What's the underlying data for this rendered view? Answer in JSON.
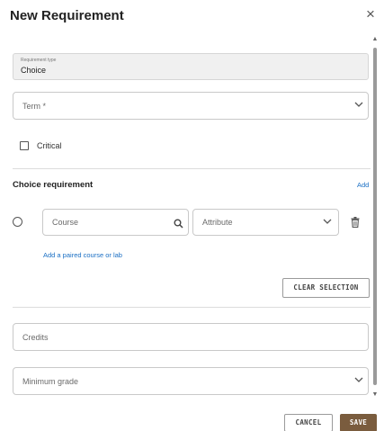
{
  "dialog": {
    "title": "New Requirement",
    "close_symbol": "×"
  },
  "requirement_type": {
    "label": "Requirement type",
    "value": "Choice"
  },
  "term": {
    "placeholder": "Term *"
  },
  "critical": {
    "label": "Critical",
    "checked": false
  },
  "choice_requirement": {
    "title": "Choice requirement",
    "add_label": "Add",
    "course_placeholder": "Course",
    "attribute_placeholder": "Attribute",
    "paired_link": "Add a paired course or lab",
    "clear_label": "CLEAR SELECTION"
  },
  "credits": {
    "placeholder": "Credits"
  },
  "minimum_grade": {
    "placeholder": "Minimum grade"
  },
  "footer": {
    "cancel_label": "CANCEL",
    "save_label": "SAVE"
  },
  "icons": {
    "close": "close-icon",
    "chevron": "chevron-down-icon",
    "search": "search-icon",
    "trash": "trash-icon",
    "scroll_up": "scroll-up-icon",
    "scroll_down": "scroll-down-icon"
  },
  "colors": {
    "primary_button": "#7a5c3e",
    "link": "#1a6fc4",
    "readonly_bg": "#f0f0f0"
  }
}
